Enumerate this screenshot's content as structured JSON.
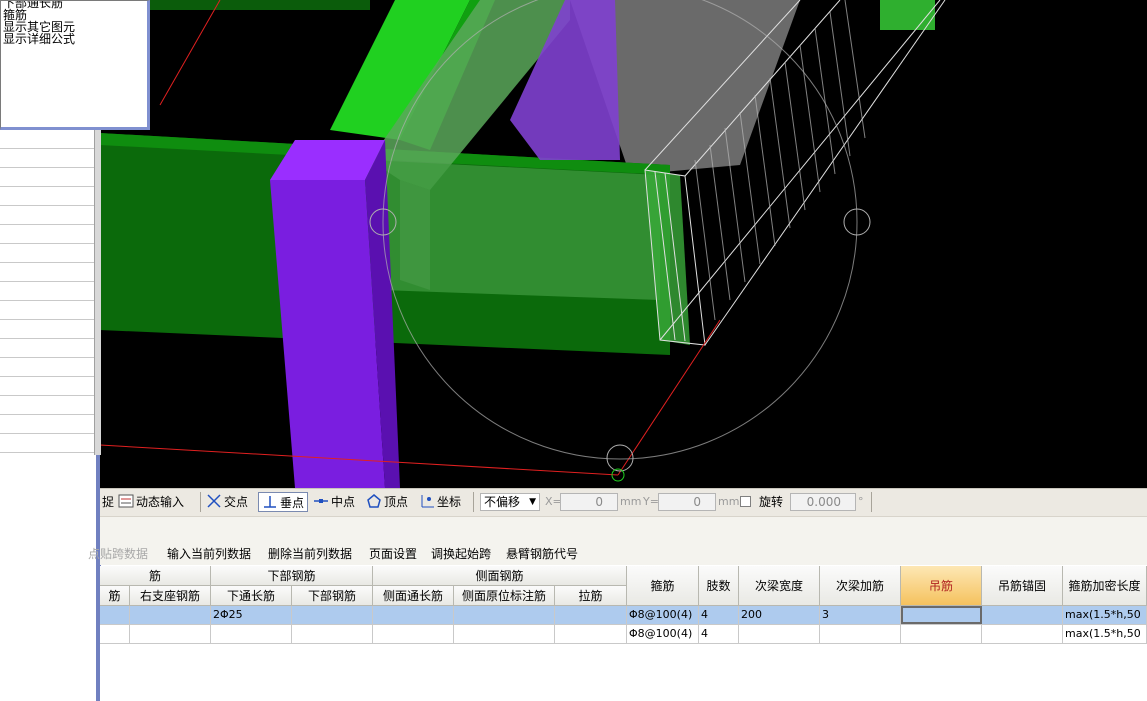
{
  "popup": {
    "items": [
      "下部通长筋",
      "箍筋",
      "显示其它图元",
      "显示详细公式"
    ]
  },
  "snap_toolbar": {
    "capture_suffix": "捉",
    "dynamic_input": "动态输入",
    "intersection": "交点",
    "perpendicular": "垂点",
    "midpoint": "中点",
    "vertex": "顶点",
    "coordinate": "坐标",
    "offset_select": "不偏移",
    "x_label": "X=",
    "x_value": "0",
    "x_unit": "mm",
    "y_label": "Y=",
    "y_value": "0",
    "y_unit": "mm",
    "rotate_label": "旋转",
    "rotate_value": "0.000",
    "degree": "°"
  },
  "edit_toolbar": {
    "items": [
      "点贴跨数据",
      "输入当前列数据",
      "删除当前列数据",
      "页面设置",
      "调换起始跨",
      "悬臂钢筋代号"
    ]
  },
  "grid": {
    "group_headers": [
      "筋",
      "下部钢筋",
      "侧面钢筋"
    ],
    "sub_headers": [
      "筋",
      "右支座钢筋",
      "下通长筋",
      "下部钢筋",
      "侧面通长筋",
      "侧面原位标注筋",
      "拉筋"
    ],
    "tall_headers": [
      "箍筋",
      "肢数",
      "次梁宽度",
      "次梁加筋",
      "吊筋",
      "吊筋锚固",
      "箍筋加密长度"
    ],
    "rows": [
      {
        "bottom_long": "2Φ25",
        "stirrup": "Φ8@100(4)",
        "legs": "4",
        "sec_width": "200",
        "sec_add": "3",
        "hang": "",
        "hang_anchor": "",
        "dense_len": "max(1.5*h,50"
      },
      {
        "bottom_long": "",
        "stirrup": "Φ8@100(4)",
        "legs": "4",
        "sec_width": "",
        "sec_add": "",
        "hang": "",
        "hang_anchor": "",
        "dense_len": "max(1.5*h,50"
      }
    ]
  },
  "colors": {
    "viewport_bg": "#000000",
    "beam_green": "#17b317",
    "column_purple": "#7a1ee0",
    "selected_header": "#f5c25e",
    "selected_row": "#aecbee"
  }
}
